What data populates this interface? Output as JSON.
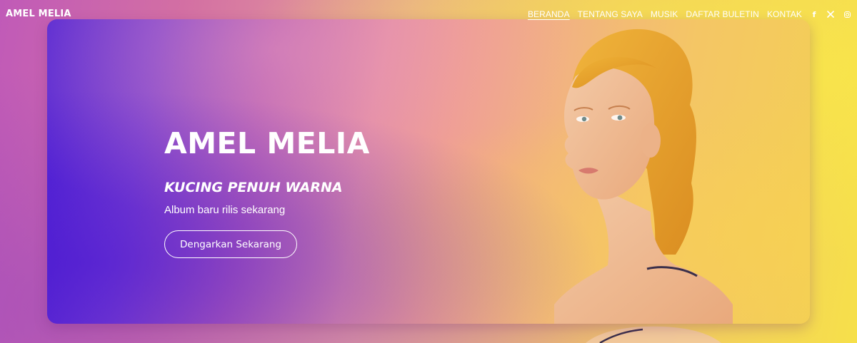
{
  "header": {
    "brand": "AMEL MELIA",
    "nav": [
      {
        "label": "BERANDA",
        "active": true
      },
      {
        "label": "TENTANG SAYA",
        "active": false
      },
      {
        "label": "MUSIK",
        "active": false
      },
      {
        "label": "DAFTAR BULETIN",
        "active": false
      },
      {
        "label": "KONTAK",
        "active": false
      }
    ],
    "social": [
      "facebook-icon",
      "x-icon",
      "instagram-icon"
    ]
  },
  "hero": {
    "title": "AMEL MELIA",
    "subtitle": "KUCING PENUH WARNA",
    "description": "Album baru rilis sekarang",
    "button_label": "Dengarkan Sekarang"
  },
  "colors": {
    "text": "#ffffff",
    "gradient_start": "#4b1fd6",
    "gradient_mid": "#e38ea4",
    "gradient_end": "#f3cf55"
  }
}
